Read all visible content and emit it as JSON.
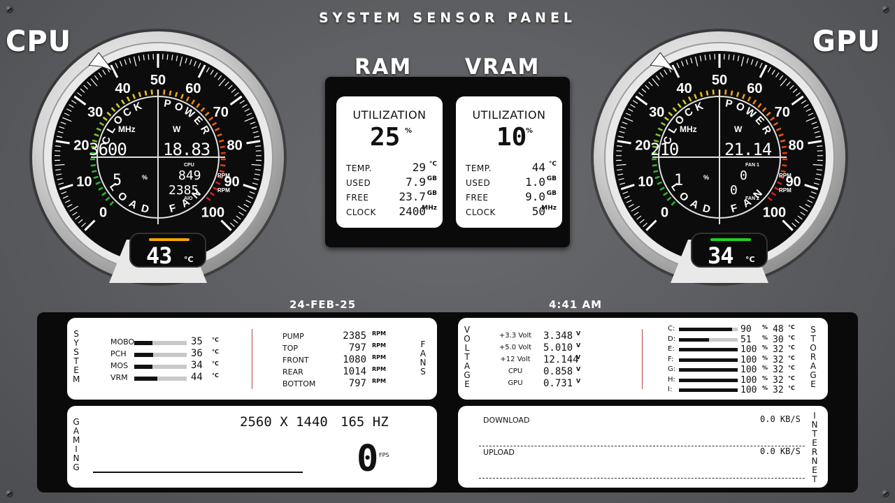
{
  "panel_title": "SYSTEM SENSOR PANEL",
  "cpu": {
    "label": "CPU",
    "scale": [
      "0",
      "10",
      "20",
      "30",
      "40",
      "50",
      "60",
      "70",
      "80",
      "90",
      "100"
    ],
    "arc_top_left": "CLOCK",
    "arc_top_right": "POWER",
    "arc_bottom_left": "LOAD",
    "arc_bottom_right": "FAN",
    "clock_unit": "MHz",
    "clock_value": "3600",
    "power_unit": "W",
    "power_value": "18.83",
    "load_value": "5",
    "load_unit": "%",
    "fan1_label": "CPU",
    "fan1_value": "849",
    "fan2_value": "2385",
    "fan2_label": "AIO",
    "rpm": "RPM",
    "temp": "43",
    "temp_unit": "°C",
    "temp_bar_color": "#f5a800"
  },
  "gpu": {
    "label": "GPU",
    "scale": [
      "0",
      "10",
      "20",
      "30",
      "40",
      "50",
      "60",
      "70",
      "80",
      "90",
      "100"
    ],
    "arc_top_left": "CLOCK",
    "arc_top_right": "POWER",
    "arc_bottom_left": "LOAD",
    "arc_bottom_right": "FAN",
    "clock_unit": "MHz",
    "clock_value": "210",
    "power_unit": "W",
    "power_value": "21.14",
    "load_value": "1",
    "load_unit": "%",
    "fan1_label": "FAN 1",
    "fan1_value": "0",
    "fan2_value": "0",
    "fan2_label": "FAN 2",
    "rpm": "RPM",
    "temp": "34",
    "temp_unit": "°C",
    "temp_bar_color": "#1fd11f"
  },
  "ram": {
    "label": "RAM",
    "util_label": "UTILIZATION",
    "util_value": "25",
    "util_unit": "%",
    "rows": [
      {
        "label": "TEMP.",
        "value": "29",
        "unit": "°C"
      },
      {
        "label": "USED",
        "value": "7.9",
        "unit": "GB"
      },
      {
        "label": "FREE",
        "value": "23.7",
        "unit": "GB"
      },
      {
        "label": "CLOCK",
        "value": "2400",
        "unit": "MHz"
      }
    ]
  },
  "vram": {
    "label": "VRAM",
    "util_label": "UTILIZATION",
    "util_value": "10",
    "util_unit": "%",
    "rows": [
      {
        "label": "TEMP.",
        "value": "44",
        "unit": "°C"
      },
      {
        "label": "USED",
        "value": "1.0",
        "unit": "GB"
      },
      {
        "label": "FREE",
        "value": "9.0",
        "unit": "GB"
      },
      {
        "label": "CLOCK",
        "value": "50",
        "unit": "MHz"
      }
    ]
  },
  "date": "24-FEB-25",
  "time": "4:41 AM",
  "system": {
    "label": "SYSTEM",
    "rows": [
      {
        "label": "MOBO",
        "value": "35",
        "unit": "°C",
        "fill": 0.35
      },
      {
        "label": "PCH",
        "value": "36",
        "unit": "°C",
        "fill": 0.36
      },
      {
        "label": "MOS",
        "value": "34",
        "unit": "°C",
        "fill": 0.34
      },
      {
        "label": "VRM",
        "value": "44",
        "unit": "°C",
        "fill": 0.44
      }
    ]
  },
  "fans": {
    "label": "FANS",
    "rows": [
      {
        "label": "PUMP",
        "value": "2385",
        "unit": "RPM"
      },
      {
        "label": "TOP",
        "value": "797",
        "unit": "RPM"
      },
      {
        "label": "FRONT",
        "value": "1080",
        "unit": "RPM"
      },
      {
        "label": "REAR",
        "value": "1014",
        "unit": "RPM"
      },
      {
        "label": "BOTTOM",
        "value": "797",
        "unit": "RPM"
      }
    ]
  },
  "voltage": {
    "label": "VOLTAGE",
    "rows": [
      {
        "label": "+3.3 Volt",
        "value": "3.348",
        "unit": "V"
      },
      {
        "label": "+5.0 Volt",
        "value": "5.010",
        "unit": "V"
      },
      {
        "label": "+12 Volt",
        "value": "12.144",
        "unit": "V"
      },
      {
        "label": "CPU",
        "value": "0.858",
        "unit": "V"
      },
      {
        "label": "GPU",
        "value": "0.731",
        "unit": "V"
      }
    ]
  },
  "storage": {
    "label": "STORAGE",
    "rows": [
      {
        "label": "C:",
        "pct": "90",
        "fill": 0.9,
        "temp": "48"
      },
      {
        "label": "D:",
        "pct": "51",
        "fill": 0.51,
        "temp": "30"
      },
      {
        "label": "E:",
        "pct": "100",
        "fill": 1.0,
        "temp": "32"
      },
      {
        "label": "F:",
        "pct": "100",
        "fill": 1.0,
        "temp": "32"
      },
      {
        "label": "G:",
        "pct": "100",
        "fill": 1.0,
        "temp": "32"
      },
      {
        "label": "H:",
        "pct": "100",
        "fill": 1.0,
        "temp": "32"
      },
      {
        "label": "I:",
        "pct": "100",
        "fill": 1.0,
        "temp": "32"
      }
    ],
    "pct_unit": "%",
    "temp_unit": "°C"
  },
  "gaming": {
    "label": "GAMING",
    "resolution": "2560 X 1440",
    "refresh": "165 HZ",
    "fps_value": "0",
    "fps_unit": "FPS"
  },
  "internet": {
    "label": "INTERNET",
    "download_label": "DOWNLOAD",
    "download_value": "0.0 KB/S",
    "upload_label": "UPLOAD",
    "upload_value": "0.0 KB/S"
  }
}
